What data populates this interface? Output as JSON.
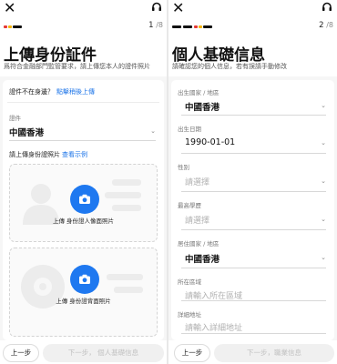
{
  "left": {
    "step_current": "1",
    "step_total": "/8",
    "title": "上傳身份証件",
    "subtitle": "爲符合金融部門監管要求，請上傳您本人的證件照片",
    "hint_question": "證件不在身邊？",
    "hint_link": "點擊稍後上傳",
    "region_label": "證件",
    "region_value": "中國香港",
    "upload_label": "請上傳身份證照片",
    "upload_example": "查看示例",
    "front_caption": "上傳 身份證人像面照片",
    "back_caption": "上傳 身份證背面照片",
    "prev_button": "上一步",
    "next_button": "下一步， 個人基礎信息"
  },
  "right": {
    "step_current": "2",
    "step_total": "/8",
    "title": "個人基礎信息",
    "subtitle": "請確認您的個人信息，若有誤請手動修改",
    "birth_place_label": "出生國家 / 地區",
    "birth_place_value": "中國香港",
    "dob_label": "出生日期",
    "dob_value": "1990-01-01",
    "gender_label": "性别",
    "gender_placeholder": "請選擇",
    "education_label": "最高學歷",
    "education_placeholder": "請選擇",
    "residence_label": "居住國家 / 地區",
    "residence_value": "中國香港",
    "district_label": "所在區域",
    "district_placeholder": "請輸入所在區域",
    "address_label": "詳細地址",
    "address_placeholder": "請輸入詳細地址",
    "prev_button": "上一步",
    "next_button": "下一步，職業信息"
  },
  "colors": {
    "accent_blue": "#1e78f0",
    "progress_red": "#e53935",
    "progress_yellow": "#f5b400",
    "progress_dark": "#111111"
  },
  "icons": [
    "close-icon",
    "headset-icon",
    "camera-icon",
    "chevron-down-icon"
  ]
}
